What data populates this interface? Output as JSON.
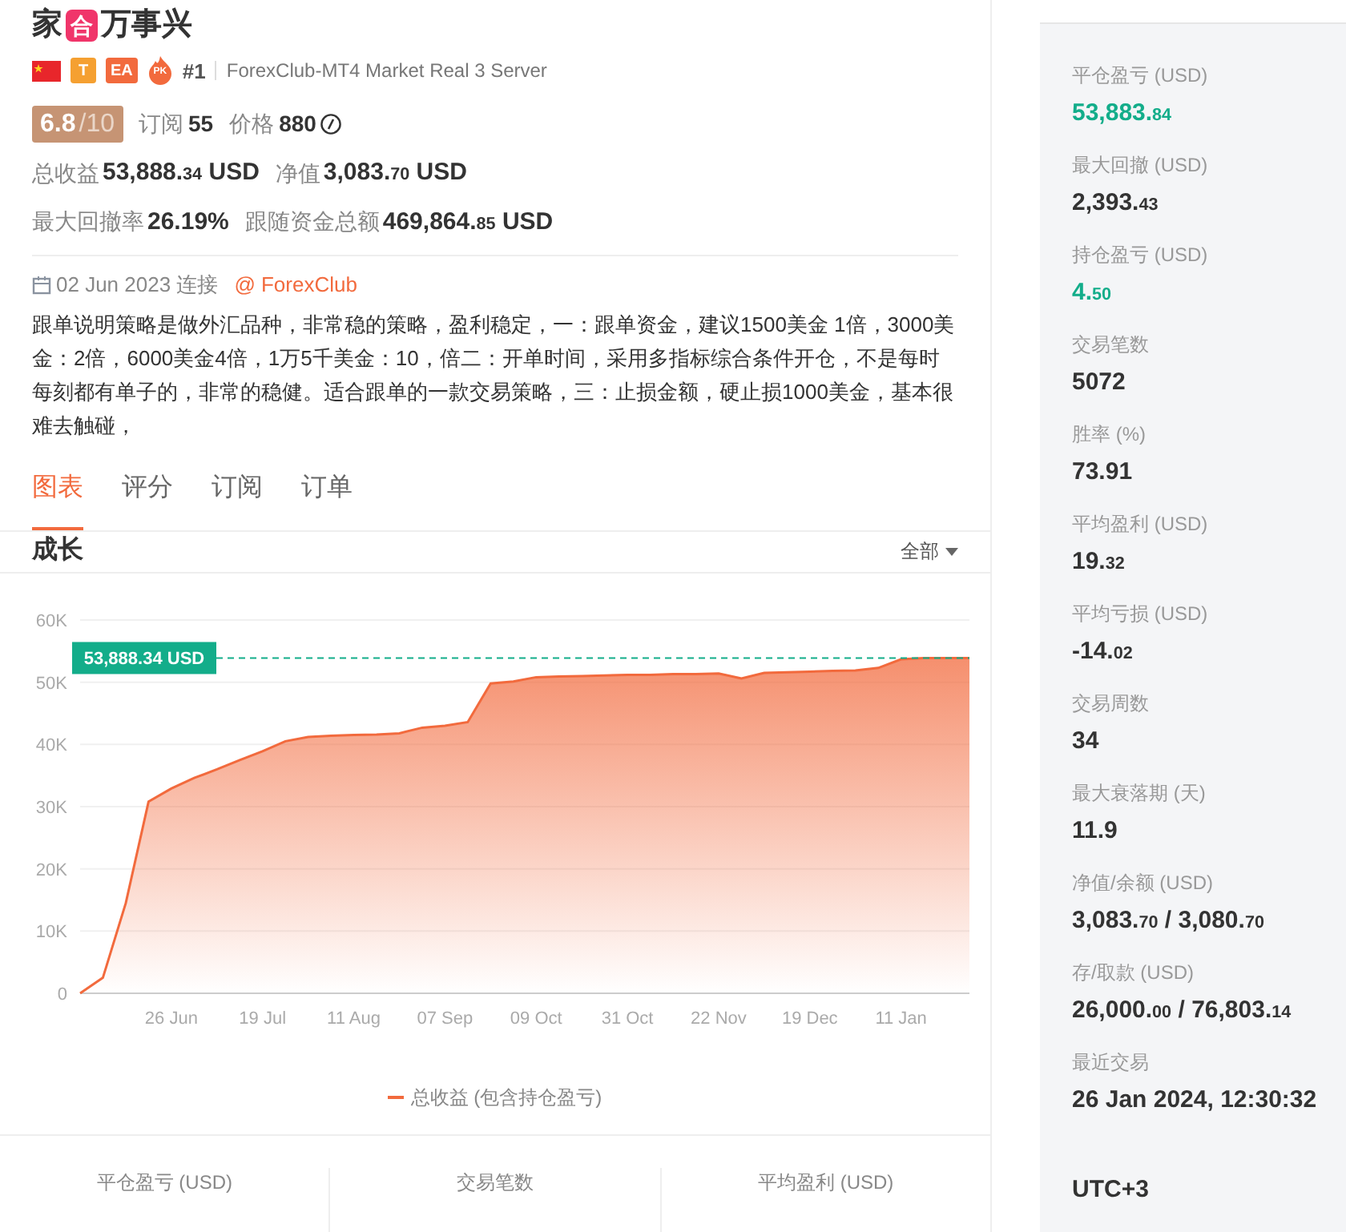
{
  "header": {
    "title_parts": [
      {
        "kind": "text",
        "text": "家"
      },
      {
        "kind": "emoji",
        "text": "合"
      },
      {
        "kind": "text",
        "text": "万事兴"
      }
    ],
    "badges": [
      {
        "kind": "flag"
      },
      {
        "kind": "tag",
        "text": "T",
        "color": "#f5a031"
      },
      {
        "kind": "tag",
        "text": "EA",
        "color": "#f26a3d"
      },
      {
        "kind": "flame",
        "text": "PK"
      }
    ],
    "rank": "#1",
    "server": "ForexClub-MT4 Market Real 3 Server",
    "rating": "6.8",
    "rating_max": "/10",
    "inline_stats": [
      {
        "label": "订阅",
        "value": {
          "main": "55"
        }
      },
      {
        "label": "价格",
        "value": {
          "main": "880"
        }
      }
    ],
    "stats": [
      [
        {
          "label": "总收益",
          "value": {
            "main": "53,888.",
            "fraction": "34",
            "unit": " USD"
          }
        },
        {
          "label": "净值",
          "value": {
            "main": "3,083.",
            "fraction": "70",
            "unit": " USD"
          }
        }
      ],
      [
        {
          "label": "最大回撤率",
          "value": {
            "main": "26.19%"
          }
        },
        {
          "label": "跟随资金总额",
          "value": {
            "main": "469,864.",
            "fraction": "85",
            "unit": " USD"
          }
        }
      ]
    ],
    "connected": "02 Jun 2023 连接",
    "broker": "@ ForexClub",
    "description": "跟单说明策略是做外汇品种，非常稳的策略，盈利稳定，一：跟单资金，建议1500美金 1倍，3000美金：2倍，6000美金4倍，1万5千美金：10，倍二：开单时间，采用多指标综合条件开仓，不是每时每刻都有单子的，非常的稳健。适合跟单的一款交易策略，三：止损金额，硬止损1000美金，基本很难去触碰，"
  },
  "tabs": [
    {
      "label": "图表",
      "selected": true
    },
    {
      "label": "评分",
      "selected": false
    },
    {
      "label": "订阅",
      "selected": false
    },
    {
      "label": "订单",
      "selected": false
    }
  ],
  "growth": {
    "title": "成长",
    "range": "全部",
    "chart_data": {
      "type": "area",
      "categories": [
        null,
        null,
        null,
        null,
        "26 Jun",
        null,
        null,
        null,
        "19 Jul",
        null,
        null,
        null,
        "11 Aug",
        null,
        null,
        null,
        "07 Sep",
        null,
        null,
        null,
        "09 Oct",
        null,
        null,
        null,
        "31 Oct",
        null,
        null,
        null,
        "22 Nov",
        null,
        null,
        null,
        "19 Dec",
        null,
        null,
        null,
        "11 Jan",
        null,
        null,
        null
      ],
      "series": [
        {
          "name": "总收益 (包含持仓盈亏)",
          "color": "#f26a3d",
          "values": [
            0,
            2500,
            14500,
            30800,
            32900,
            34600,
            36000,
            37500,
            38900,
            40500,
            41200,
            41400,
            41500,
            41600,
            41800,
            42700,
            43000,
            43600,
            49800,
            50100,
            50800,
            50900,
            51000,
            51100,
            51200,
            51200,
            51300,
            51300,
            51400,
            50600,
            51500,
            51600,
            51700,
            51800,
            51900,
            52300,
            53700,
            53900,
            53900,
            53900
          ]
        }
      ],
      "ylim": [
        0,
        60000
      ],
      "yticks": [
        {
          "value": 0,
          "label": "0"
        },
        {
          "value": 10000,
          "label": "10K"
        },
        {
          "value": 20000,
          "label": "20K"
        },
        {
          "value": 30000,
          "label": "30K"
        },
        {
          "value": 40000,
          "label": "40K"
        },
        {
          "value": 50000,
          "label": "50K"
        },
        {
          "value": 60000,
          "label": "60K"
        }
      ],
      "grid": true,
      "ref_lines": [
        {
          "axis": "y",
          "value": 53888.34,
          "label": "53,888.34 USD"
        }
      ]
    }
  },
  "bottom_stats": [
    {
      "label": "平仓盈亏 (USD)"
    },
    {
      "label": "交易笔数"
    },
    {
      "label": "平均盈利 (USD)"
    }
  ],
  "sidebar": [
    {
      "label": "平仓盈亏 (USD)",
      "color": "#13ad8a",
      "value": [
        {
          "main": "53,883.",
          "fraction": "84"
        }
      ]
    },
    {
      "label": "最大回撤 (USD)",
      "color": "#333333",
      "value": [
        {
          "main": "2,393.",
          "fraction": "43"
        }
      ]
    },
    {
      "label": "持仓盈亏 (USD)",
      "color": "#13ad8a",
      "value": [
        {
          "main": "4.",
          "fraction": "50"
        }
      ]
    },
    {
      "label": "交易笔数",
      "color": "#333333",
      "value": [
        {
          "main": "5072"
        }
      ]
    },
    {
      "label": "胜率 (%)",
      "color": "#333333",
      "value": [
        {
          "main": "73.91"
        }
      ]
    },
    {
      "label": "平均盈利 (USD)",
      "color": "#333333",
      "value": [
        {
          "main": "19.",
          "fraction": "32"
        }
      ]
    },
    {
      "label": "平均亏损 (USD)",
      "color": "#333333",
      "value": [
        {
          "main": "-14.",
          "fraction": "02"
        }
      ]
    },
    {
      "label": "交易周数",
      "color": "#333333",
      "value": [
        {
          "main": "34"
        }
      ]
    },
    {
      "label": "最大衰落期 (天)",
      "color": "#333333",
      "value": [
        {
          "main": "11.9"
        }
      ]
    },
    {
      "label": "净值/余额 (USD)",
      "color": "#333333",
      "value": [
        {
          "main": "3,083.",
          "fraction": "70"
        },
        {
          "main": " / 3,080.",
          "fraction": "70"
        }
      ]
    },
    {
      "label": "存/取款 (USD)",
      "color": "#333333",
      "value": [
        {
          "main": "26,000.",
          "fraction": "00"
        },
        {
          "main": " / 76,803.",
          "fraction": "14"
        }
      ]
    },
    {
      "label": "最近交易",
      "color": "#333333",
      "value": [
        {
          "main": "26 Jan 2024, 12:30:32"
        }
      ]
    },
    {
      "color": "#333333",
      "value": [
        {
          "main": "UTC+3"
        }
      ]
    }
  ]
}
